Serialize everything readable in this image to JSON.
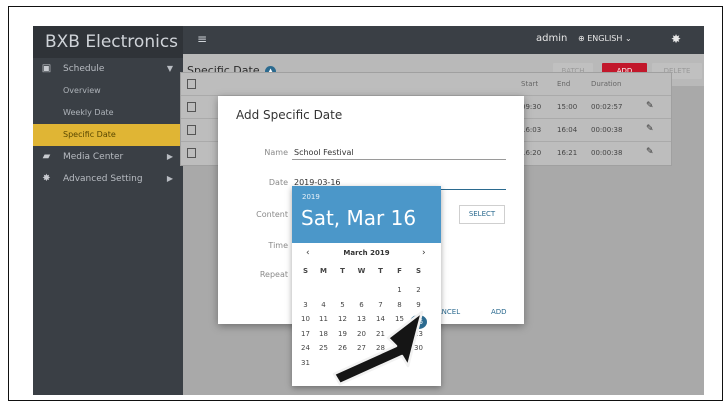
{
  "app": {
    "brand": "BXB Electronics",
    "user": "admin",
    "language": "ENGLISH"
  },
  "sidebar": {
    "items": [
      {
        "label": "Schedule",
        "icon": "calendar-icon"
      },
      {
        "label": "Overview"
      },
      {
        "label": "Weekly Date"
      },
      {
        "label": "Specific Date"
      },
      {
        "label": "Media Center",
        "icon": "folder-icon"
      },
      {
        "label": "Advanced Setting",
        "icon": "gear-icon"
      }
    ]
  },
  "toolbar": {
    "title": "Specific Date",
    "batch_label": "BATCH",
    "add_label": "ADD",
    "delete_label": "DELETE"
  },
  "table": {
    "columns": [
      "Start",
      "End",
      "Duration"
    ],
    "rows": [
      {
        "start": "09:30",
        "end": "15:00",
        "duration": "00:02:57"
      },
      {
        "start": "16:03",
        "end": "16:04",
        "duration": "00:00:38"
      },
      {
        "start": "16:20",
        "end": "16:21",
        "duration": "00:00:38"
      }
    ]
  },
  "modal": {
    "title": "Add Specific Date",
    "fields": {
      "name_label": "Name",
      "name_value": "School Festival",
      "date_label": "Date",
      "date_value": "2019-03-16",
      "content_label": "Content",
      "time_label": "Time",
      "repeat_label": "Repeat"
    },
    "select_label": "SELECT",
    "cancel_label": "CANCEL",
    "add_label": "ADD"
  },
  "datepicker": {
    "year": "2019",
    "selected_display": "Sat, Mar 16",
    "month_label": "March 2019",
    "weekdays": [
      "S",
      "M",
      "T",
      "W",
      "T",
      "F",
      "S"
    ],
    "selected_day": "16",
    "weeks": [
      [
        "",
        "",
        "",
        "",
        "",
        "1",
        "2"
      ],
      [
        "3",
        "4",
        "5",
        "6",
        "7",
        "8",
        "9"
      ],
      [
        "10",
        "11",
        "12",
        "13",
        "14",
        "15",
        "16"
      ],
      [
        "17",
        "18",
        "19",
        "20",
        "21",
        "22",
        "23"
      ],
      [
        "24",
        "25",
        "26",
        "27",
        "28",
        "29",
        "30"
      ],
      [
        "31",
        "",
        "",
        "",
        "",
        "",
        ""
      ]
    ]
  },
  "colors": {
    "accent": "#2b6a8f",
    "picker_header": "#4b97c9",
    "add_button": "#c2182b",
    "active_nav": "#e0b534",
    "sidebar": "#3a3f45"
  }
}
